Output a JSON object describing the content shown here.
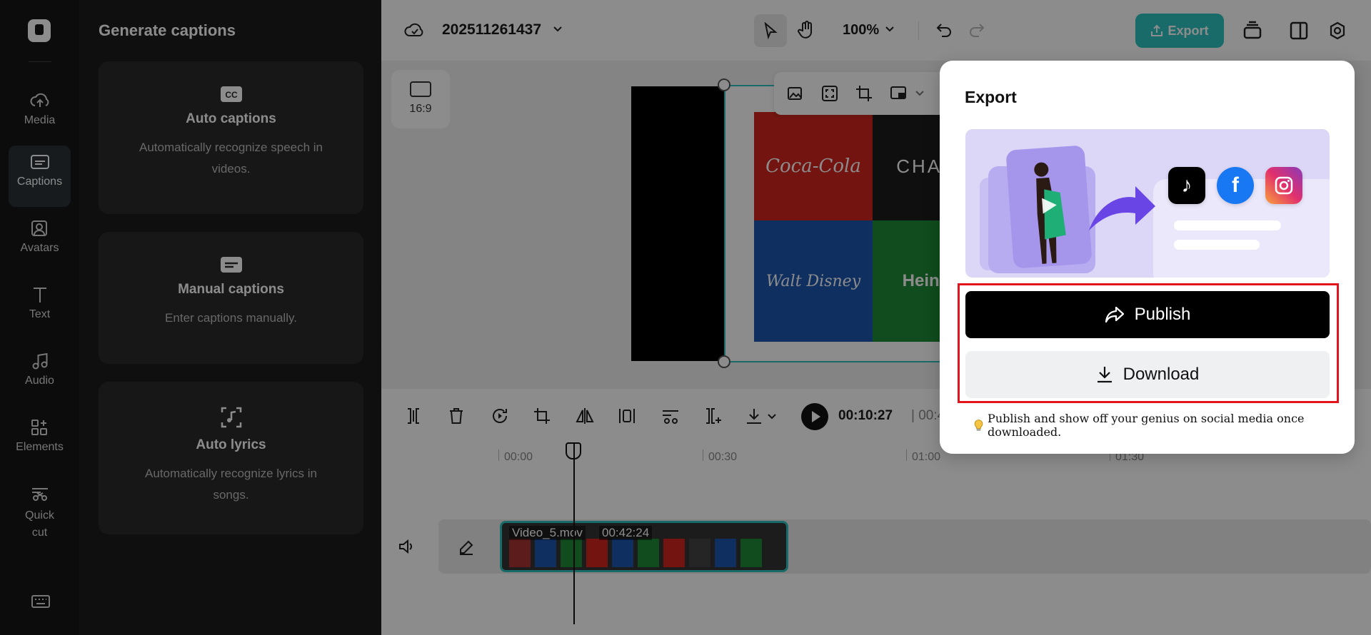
{
  "rail": {
    "items": [
      {
        "label": "Media",
        "icon": "cloud-upload-icon"
      },
      {
        "label": "Captions",
        "icon": "captions-icon",
        "active": true
      },
      {
        "label": "Avatars",
        "icon": "avatar-icon"
      },
      {
        "label": "Text",
        "icon": "text-icon"
      },
      {
        "label": "Audio",
        "icon": "music-note-icon"
      },
      {
        "label": "Elements",
        "icon": "elements-icon"
      },
      {
        "label": "Quick cut",
        "icon": "scissors-icon"
      }
    ]
  },
  "panel": {
    "title": "Generate captions",
    "cards": [
      {
        "title": "Auto captions",
        "desc": "Automatically recognize speech in videos.",
        "icon": "cc-icon"
      },
      {
        "title": "Manual captions",
        "desc": "Enter captions manually.",
        "icon": "keyboard-caption-icon"
      },
      {
        "title": "Auto lyrics",
        "desc": "Automatically recognize lyrics in songs.",
        "icon": "lyrics-icon"
      }
    ]
  },
  "topbar": {
    "project_name": "202511261437",
    "zoom": "100%",
    "export_label": "Export"
  },
  "canvas": {
    "ratio": "16:9",
    "tiles": [
      "Coca-Cola",
      "CHANEL",
      "Walt Disney",
      "Heineken"
    ]
  },
  "playback": {
    "current": "00:10:27",
    "total": "| 00:4"
  },
  "timeline": {
    "ruler": [
      "00:00",
      "00:30",
      "01:00",
      "01:30"
    ],
    "clip_name": "Video_5.mov",
    "clip_duration": "00:42:24"
  },
  "export_popup": {
    "title": "Export",
    "publish_label": "Publish",
    "download_label": "Download",
    "hint": "Publish and show off your genius on social media once downloaded.",
    "social": [
      "TikTok",
      "Facebook",
      "Instagram"
    ]
  },
  "colors": {
    "accent": "#2fc4bf",
    "highlight": "#e4141c",
    "banner": "#dcd7f6"
  }
}
